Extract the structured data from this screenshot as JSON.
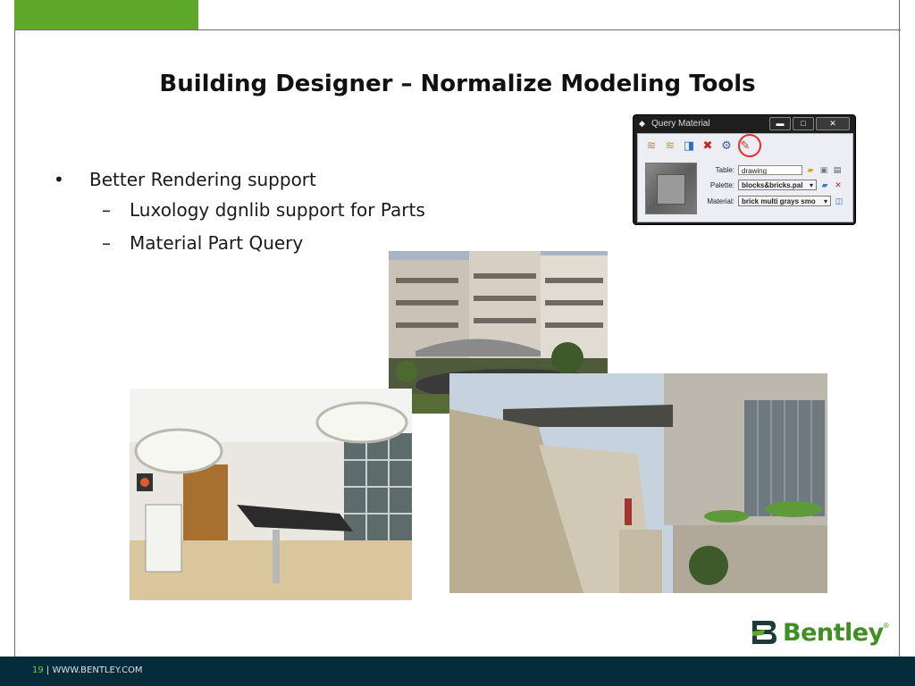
{
  "slide": {
    "title": "Building Designer – Normalize Modeling Tools",
    "bullets": [
      {
        "text": "Better Rendering support",
        "children": [
          "Luxology dgnlib support for Parts",
          "Material Part Query"
        ]
      }
    ],
    "bullet_glyph": "•",
    "dash_glyph": "–"
  },
  "dialog": {
    "title": "Query Material",
    "window_buttons": {
      "minimize": "▬",
      "maximize": "□",
      "close": "✕"
    },
    "table_label": "Table:",
    "table_value": "drawing",
    "palette_label": "Palette:",
    "palette_value": "blocks&bricks.pal",
    "material_label": "Material:",
    "material_value": "brick multi grays smo",
    "toolbar_icons": [
      "layers-icon",
      "layers-alt-icon",
      "assign-icon",
      "remove-icon",
      "query-icon",
      "paint-brush-icon"
    ]
  },
  "footer": {
    "page_number": "19",
    "separator": " | ",
    "url": "WWW.BENTLEY.COM"
  },
  "logo": {
    "word": "Bentley",
    "mark": "B",
    "tm": "®"
  },
  "colors": {
    "brand_green": "#5ea82a",
    "footer_bg": "#062b3a",
    "highlight_red": "#e03030"
  }
}
